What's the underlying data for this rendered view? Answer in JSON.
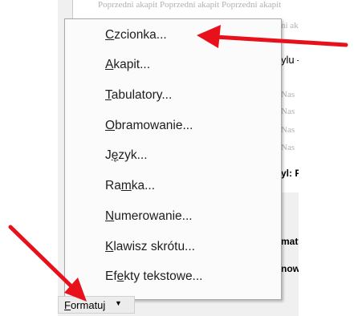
{
  "background_text": {
    "top_line": "Poprzedni akapit Poprzedni akapit Poprzedni akapit",
    "line_ak": "ni ak",
    "styl_label": "ylu –",
    "nas": [
      "Nas",
      "Nas",
      "Nas",
      "Nas"
    ],
    "styl_po": "yl: Po",
    "formaty": "matyw",
    "nowy": "nowy"
  },
  "menu": {
    "items": [
      {
        "label": "Czcionka...",
        "accel": "C"
      },
      {
        "label": "Akapit...",
        "accel": "A"
      },
      {
        "label": "Tabulatory...",
        "accel": "T"
      },
      {
        "label": "Obramowanie...",
        "accel": "O"
      },
      {
        "label": "Język...",
        "accel": "ę"
      },
      {
        "label": "Ramka...",
        "accel": "m"
      },
      {
        "label": "Numerowanie...",
        "accel": "N"
      },
      {
        "label": "Klawisz skrótu...",
        "accel": "K"
      },
      {
        "label": "Efekty tekstowe...",
        "accel": "e"
      }
    ]
  },
  "format_button": {
    "label": "Formatuj",
    "accel": "F"
  },
  "colors": {
    "arrow": "#e8101a",
    "menu_bg": "#fbfbfb",
    "dialog_bg": "#f0f0f0"
  }
}
